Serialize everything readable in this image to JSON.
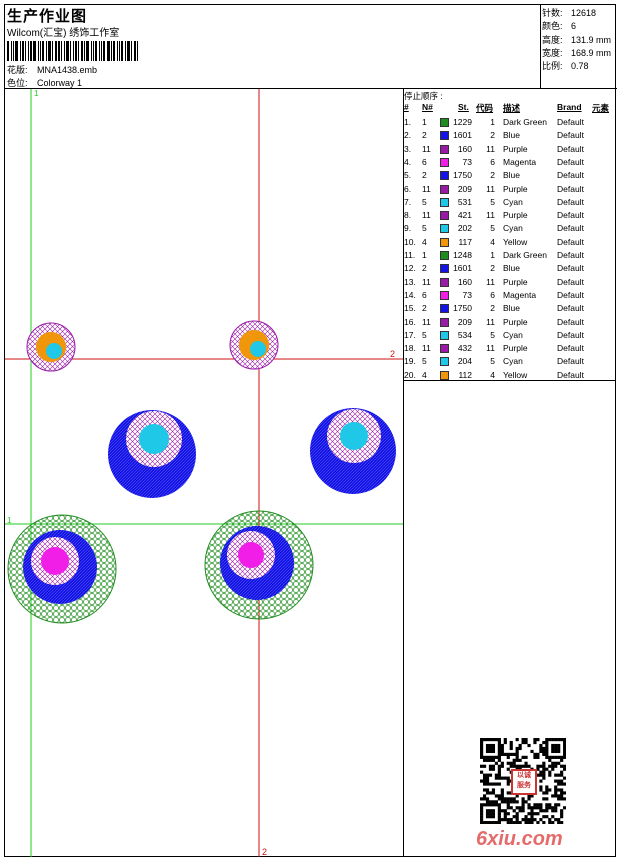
{
  "header": {
    "title": "生产作业图",
    "company": "Wilcom(汇宝) 绣饰工作室",
    "design_label": "花版:",
    "design_value": "MNA1438.emb",
    "colorway_label": "色位:",
    "colorway_value": "Colorway 1"
  },
  "stats": {
    "stitches_label": "针数:",
    "stitches_value": "12618",
    "colors_label": "颜色:",
    "colors_value": "6",
    "height_label": "高度:",
    "height_value": "131.9 mm",
    "width_label": "宽度:",
    "width_value": "168.9 mm",
    "scale_label": "比例:",
    "scale_value": "0.78"
  },
  "canvas": {
    "guide_green_v": "1",
    "guide_green_h": "1",
    "guide_red_h": "2",
    "guide_red_v": "2"
  },
  "colors": {
    "dark_green": "#1e8c1e",
    "blue": "#1414e6",
    "purple": "#9a1aa8",
    "magenta": "#f01ee6",
    "cyan": "#1ec8e6",
    "yellow": "#f0960a",
    "guide_green": "#22cc22",
    "guide_red": "#cc1111"
  },
  "table": {
    "section_title": "停止顺序 :",
    "headers": [
      "#",
      "N#",
      "St.",
      "代码",
      "描述",
      "Brand",
      "元素"
    ],
    "rows": [
      {
        "n": "1.",
        "code": "1",
        "st": "1229",
        "c": "1",
        "desc": "Dark Green",
        "brand": "Default",
        "color": "#1e8c1e"
      },
      {
        "n": "2.",
        "code": "2",
        "st": "1601",
        "c": "2",
        "desc": "Blue",
        "brand": "Default",
        "color": "#1414e6"
      },
      {
        "n": "3.",
        "code": "11",
        "st": "160",
        "c": "11",
        "desc": "Purple",
        "brand": "Default",
        "color": "#9a1aa8"
      },
      {
        "n": "4.",
        "code": "6",
        "st": "73",
        "c": "6",
        "desc": "Magenta",
        "brand": "Default",
        "color": "#f01ee6"
      },
      {
        "n": "5.",
        "code": "2",
        "st": "1750",
        "c": "2",
        "desc": "Blue",
        "brand": "Default",
        "color": "#1414e6"
      },
      {
        "n": "6.",
        "code": "11",
        "st": "209",
        "c": "11",
        "desc": "Purple",
        "brand": "Default",
        "color": "#9a1aa8"
      },
      {
        "n": "7.",
        "code": "5",
        "st": "531",
        "c": "5",
        "desc": "Cyan",
        "brand": "Default",
        "color": "#1ec8e6"
      },
      {
        "n": "8.",
        "code": "11",
        "st": "421",
        "c": "11",
        "desc": "Purple",
        "brand": "Default",
        "color": "#9a1aa8"
      },
      {
        "n": "9.",
        "code": "5",
        "st": "202",
        "c": "5",
        "desc": "Cyan",
        "brand": "Default",
        "color": "#1ec8e6"
      },
      {
        "n": "10.",
        "code": "4",
        "st": "117",
        "c": "4",
        "desc": "Yellow",
        "brand": "Default",
        "color": "#f0960a"
      },
      {
        "n": "11.",
        "code": "1",
        "st": "1248",
        "c": "1",
        "desc": "Dark Green",
        "brand": "Default",
        "color": "#1e8c1e"
      },
      {
        "n": "12.",
        "code": "2",
        "st": "1601",
        "c": "2",
        "desc": "Blue",
        "brand": "Default",
        "color": "#1414e6"
      },
      {
        "n": "13.",
        "code": "11",
        "st": "160",
        "c": "11",
        "desc": "Purple",
        "brand": "Default",
        "color": "#9a1aa8"
      },
      {
        "n": "14.",
        "code": "6",
        "st": "73",
        "c": "6",
        "desc": "Magenta",
        "brand": "Default",
        "color": "#f01ee6"
      },
      {
        "n": "15.",
        "code": "2",
        "st": "1750",
        "c": "2",
        "desc": "Blue",
        "brand": "Default",
        "color": "#1414e6"
      },
      {
        "n": "16.",
        "code": "11",
        "st": "209",
        "c": "11",
        "desc": "Purple",
        "brand": "Default",
        "color": "#9a1aa8"
      },
      {
        "n": "17.",
        "code": "5",
        "st": "534",
        "c": "5",
        "desc": "Cyan",
        "brand": "Default",
        "color": "#1ec8e6"
      },
      {
        "n": "18.",
        "code": "11",
        "st": "432",
        "c": "11",
        "desc": "Purple",
        "brand": "Default",
        "color": "#9a1aa8"
      },
      {
        "n": "19.",
        "code": "5",
        "st": "204",
        "c": "5",
        "desc": "Cyan",
        "brand": "Default",
        "color": "#1ec8e6"
      },
      {
        "n": "20.",
        "code": "4",
        "st": "112",
        "c": "4",
        "desc": "Yellow",
        "brand": "Default",
        "color": "#f0960a"
      }
    ]
  },
  "stamp": {
    "text_top": "以诚",
    "text_bottom": "服务"
  },
  "watermark": "6xiu.com"
}
